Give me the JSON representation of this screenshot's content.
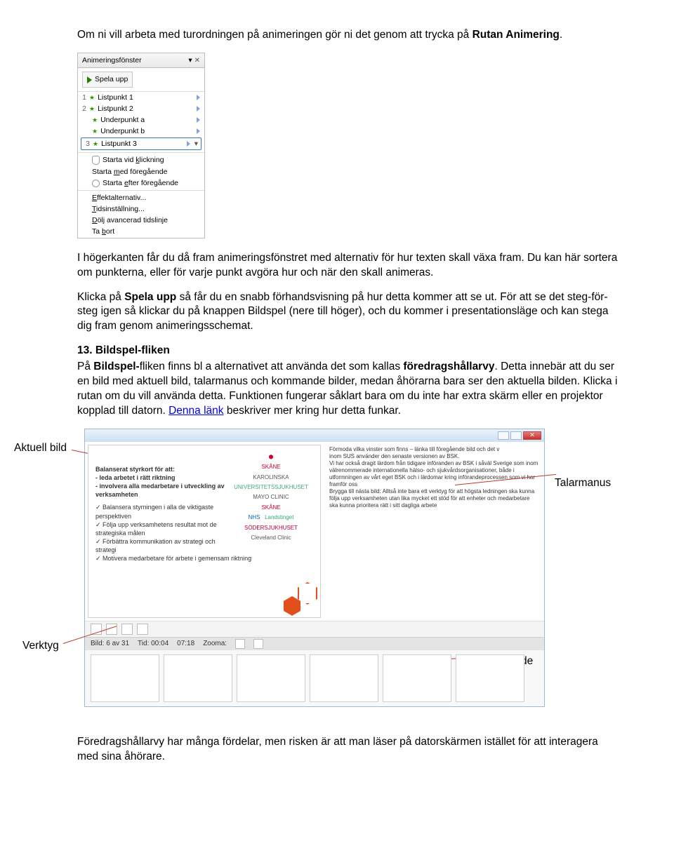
{
  "intro_para": {
    "p1a": "Om ni vill arbeta med turordningen på animeringen gör ni det genom att trycka på ",
    "p1b": "Rutan Animering",
    "p1c": "."
  },
  "anim_pane": {
    "title": "Animeringsfönster",
    "play": "Spela upp",
    "rows": [
      {
        "num": "1",
        "label": "Listpunkt 1"
      },
      {
        "num": "2",
        "label": "Listpunkt 2"
      },
      {
        "num": "",
        "label": "Underpunkt a"
      },
      {
        "num": "",
        "label": "Underpunkt b"
      },
      {
        "num": "3",
        "label": "Listpunkt 3"
      }
    ],
    "ctx": {
      "click": "Starta vid klickning",
      "click_u": "k",
      "with": "Starta med föregående",
      "with_u": "m",
      "after": "Starta efter föregående",
      "after_u": "e",
      "effect": "Effektalternativ...",
      "effect_u": "E",
      "timing": "Tidsinställning...",
      "timing_u": "T",
      "hide": "Dölj avancerad tidslinje",
      "hide_u": "D",
      "remove": "Ta bort",
      "remove_u": "b"
    }
  },
  "para2": "I högerkanten får du då fram animeringsfönstret med alternativ för hur texten skall växa fram. Du kan här sortera om punkterna, eller för varje punkt avgöra hur och när den skall animeras.",
  "para3_a": "Klicka på ",
  "para3_b": "Spela upp",
  "para3_c": " så får du en snabb förhandsvisning på hur detta kommer att se ut. För att se det steg-för-steg igen så klickar du på knappen Bildspel (nere till höger), och du kommer i presentationsläge och kan stega dig fram genom animeringsschemat.",
  "h13": "13. Bildspel-fliken",
  "para4_a": "På ",
  "para4_b": "Bildspel-",
  "para4_c": "fliken finns bl a alternativet att använda det som kallas ",
  "para4_d": "föredragshållarvy",
  "para4_e": ". Detta innebär att du ser en bild med aktuell bild, talarmanus och kommande bilder, medan åhörarna bara ser den aktuella bilden. Klicka i rutan om du vill använda detta. Funktionen fungerar såklart bara om du inte har extra skärm eller en projektor kopplad till datorn. ",
  "para4_link": "Denna länk",
  "para4_f": " beskriver mer kring hur detta funkar.",
  "pv": {
    "label_current": "Aktuell bild",
    "label_notes": "Talarmanus",
    "label_tools": "Verktyg",
    "label_next": "Kommande bilder",
    "slide_title": "Balanserat styrkort för att:",
    "slide_b1": "- leda arbetet i rätt riktning",
    "slide_b2": "- involvera alla medarbetare i utveckling av verksamheten",
    "slide_c1": "Balansera styrningen i alla de viktigaste perspektiven",
    "slide_c2": "Följa upp verksamhetens resultat mot de strategiska målen",
    "slide_c3": "Förbättra kommunikation av strategi och strategi",
    "slide_c4": "Motivera medarbetare för arbete i gemensam riktning",
    "notes_l1": "Förmoda vilka vinster som finns – länka till föregående bild och det v",
    "notes_l2": "inom SUS använder den senaste versionen av BSK.",
    "notes_l3": "Vi har också dragit lärdom från tidigare införanden av BSK i såväl Sverige som inom välrenommerade internationella hälso- och sjukvårdsorganisationer, både i utformningen av vårt eget BSK och i lärdomar kring införandeprocessen som vi har framför oss",
    "notes_l4": "Brygga till nästa bild: Alltså inte bara ett verktyg för att högsta ledningen ska kunna följa upp verksamheten utan lika mycket ett stöd för att enheter och medarbetare ska kunna prioritera rätt i sitt dagliga arbete",
    "logos": [
      "SKÅNE",
      "KAROLINSKA",
      "UNIVERSITETSSJUKHUSET",
      "MAYO CLINIC",
      "SKÅNE",
      "NHS",
      "Landstinget",
      "SÖDERSJUKHUSET",
      "Cleveland Clinic"
    ],
    "status_slide": "Bild: 6 av 31",
    "status_time": "Tid: 00:04",
    "status_clock": "07:18",
    "status_zoom": "Zooma:"
  },
  "closing": "Föredragshållarvy har många fördelar, men risken är att man läser på datorskärmen istället för att interagera med sina åhörare."
}
